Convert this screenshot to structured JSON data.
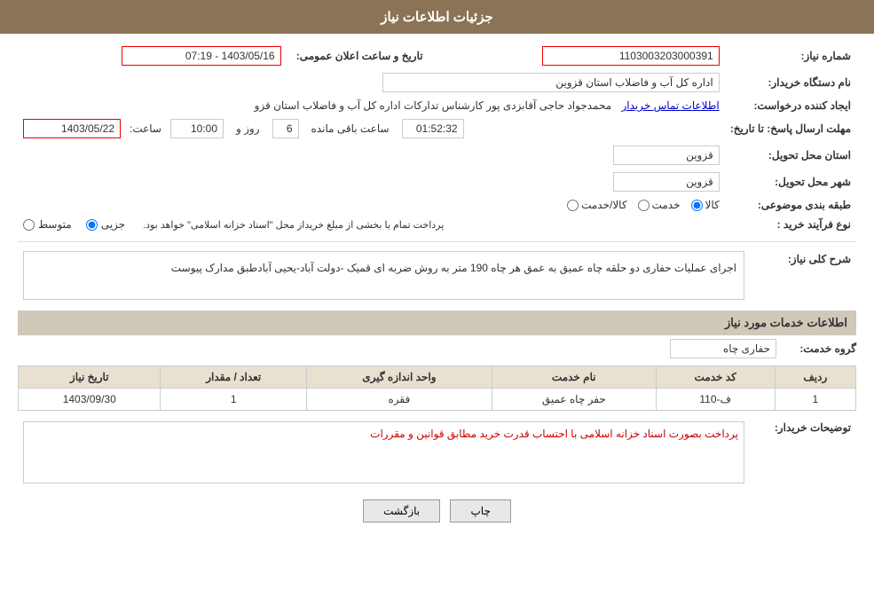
{
  "header": {
    "title": "جزئیات اطلاعات نیاز"
  },
  "fields": {
    "shomareNiaz_label": "شماره نیاز:",
    "shomareNiaz_value": "1103003203000391",
    "namDastgah_label": "نام دستگاه خریدار:",
    "namDastgah_value": "اداره کل آب و فاضلاب استان قزوین",
    "ijadKonnande_label": "ایجاد کننده درخواست:",
    "ijadKonnande_value": "محمدجواد حاجی آقابزدی پور کارشناس تدارکات اداره کل آب و فاضلاب استان قزو",
    "ijadKonnande_link": "اطلاعات تماس خریدار",
    "mohlat_label": "مهلت ارسال پاسخ: تا تاریخ:",
    "mohlat_date": "1403/05/22",
    "mohlat_saatLabel": "ساعت:",
    "mohlat_saat": "10:00",
    "mohlat_rozLabel": "روز و",
    "mohlat_roz": "6",
    "mohlat_baghimandehLabel": "ساعت باقی مانده",
    "mohlat_baghimandeh": "01:52:32",
    "taarighe_label": "تاریخ و ساعت اعلان عمومی:",
    "taarighe_value": "1403/05/16 - 07:19",
    "ostan_label": "استان محل تحویل:",
    "ostan_value": "قزوین",
    "shahr_label": "شهر محل تحویل:",
    "shahr_value": "قزوین",
    "tabaqe_label": "طبقه بندی موضوعی:",
    "tabaqe_kala": "کالا",
    "tabaqe_khedmat": "خدمت",
    "tabaqe_kala_khedmat": "کالا/خدمت",
    "tabaqe_selected": "kala",
    "noe_label": "نوع فرآیند خرید :",
    "noe_jazee": "جزیی",
    "noe_motevaset": "متوسط",
    "noe_note": "پرداخت تمام یا بخشی از مبلغ خریداز محل \"اسناد خزانه اسلامی\" خواهد بود.",
    "sharh_label": "شرح کلی نیاز:",
    "sharh_value": "اجرای عملیات حفاری  دو حلقه چاه عمیق به عمق هر چاه 190 متر  به روش ضربه ای قمیک -دولت آباد-یحیی آبادطبق مدارک پیوست",
    "khadamat_label": "اطلاعات خدمات مورد نیاز",
    "gerohKhadamat_label": "گروه خدمت:",
    "gerohKhadamat_value": "حفاری چاه",
    "table": {
      "headers": [
        "ردیف",
        "کد خدمت",
        "نام خدمت",
        "واحد اندازه گیری",
        "تعداد / مقدار",
        "تاریخ نیاز"
      ],
      "rows": [
        {
          "radif": "1",
          "kodKhadamat": "ف-110",
          "namKhadamat": "حفر چاه عمیق",
          "vahed": "فقره",
          "tedad": "1",
          "tarikh": "1403/09/30"
        }
      ]
    },
    "tozihat_label": "توضیحات خریدار:",
    "tozihat_value": "پرداخت بصورت اسناد خزانه اسلامی با احتساب قدرت خرید مطابق قوانین و مقررات"
  },
  "buttons": {
    "chap": "چاپ",
    "bazgasht": "بازگشت"
  }
}
